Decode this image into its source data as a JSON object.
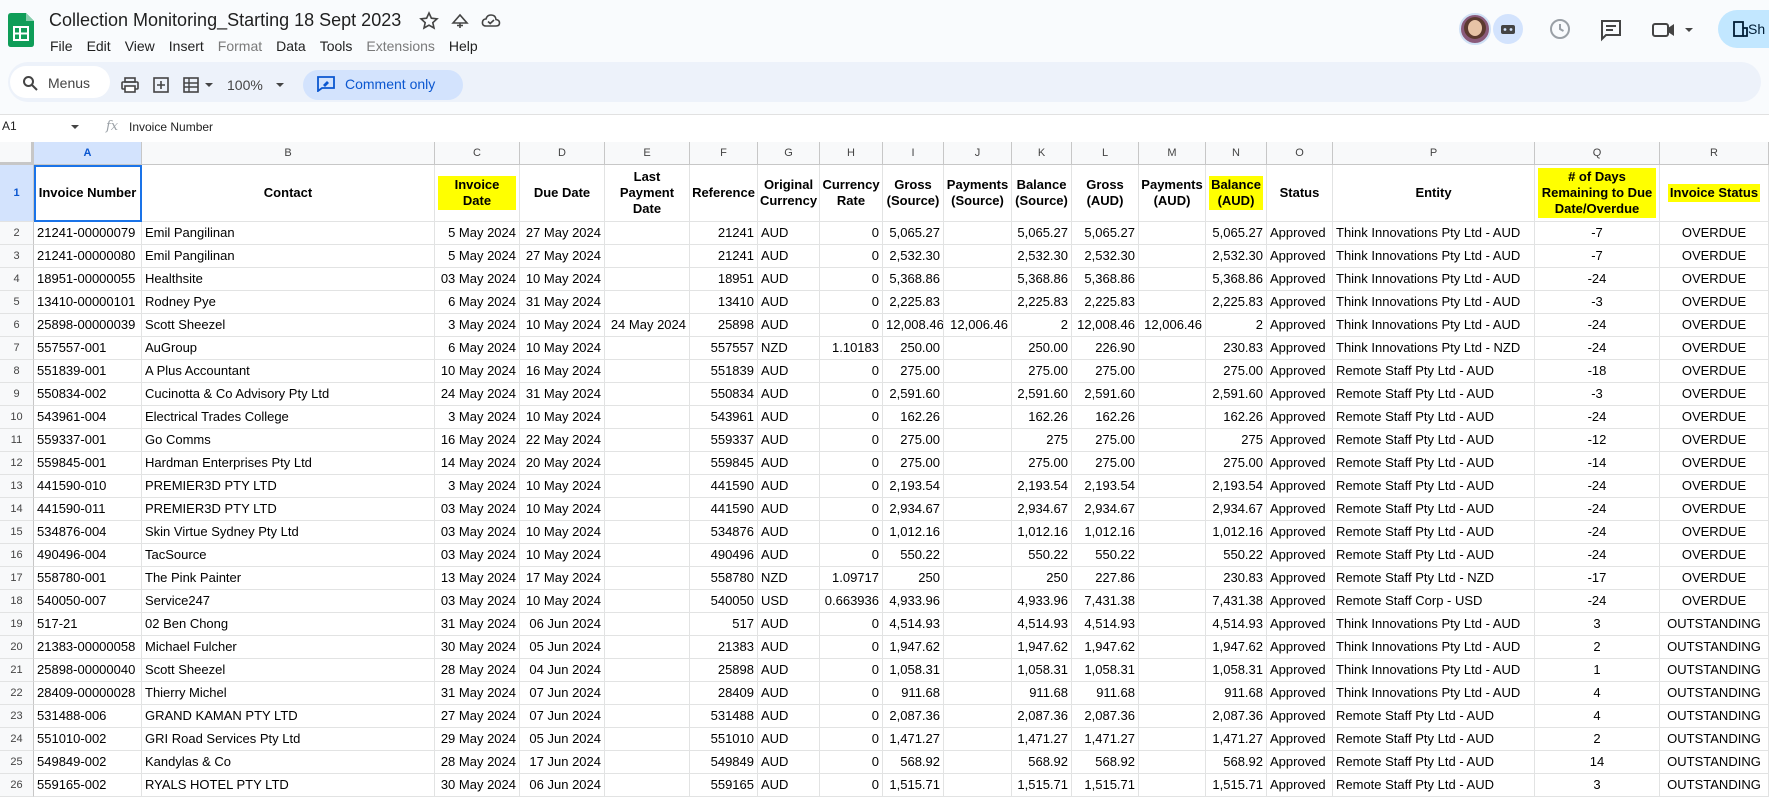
{
  "app": {
    "title": "Collection Monitoring_Starting 18 Sept 2023",
    "menu": [
      "File",
      "Edit",
      "View",
      "Insert",
      "Format",
      "Data",
      "Tools",
      "Extensions",
      "Help"
    ],
    "menu_disabled": [
      "Format",
      "Extensions"
    ],
    "share_label": "Sh"
  },
  "toolbar": {
    "menus_label": "Menus",
    "zoom": "100%",
    "comment_label": "Comment only"
  },
  "formula": {
    "name_box": "A1",
    "fx": "fx",
    "content": "Invoice Number"
  },
  "columns": [
    "A",
    "B",
    "C",
    "D",
    "E",
    "F",
    "G",
    "H",
    "I",
    "J",
    "K",
    "L",
    "M",
    "N",
    "O",
    "P",
    "Q",
    "R"
  ],
  "headers": [
    "Invoice Number",
    "Contact",
    "Invoice Date",
    "Due Date",
    "Last Payment Date",
    "Reference",
    "Original Currency",
    "Currency Rate",
    "Gross (Source)",
    "Payments (Source)",
    "Balance (Source)",
    "Gross (AUD)",
    "Payments (AUD)",
    "Balance (AUD)",
    "Status",
    "Entity",
    "# of Days Remaining to Due Date/Overdue",
    "Invoice Status"
  ],
  "highlighted_headers": [
    "C",
    "N",
    "Q",
    "R"
  ],
  "rows": [
    [
      "21241-00000079",
      "Emil Pangilinan",
      "5 May 2024",
      "27 May 2024",
      "",
      "21241",
      "AUD",
      "0",
      "5,065.27",
      "",
      "5,065.27",
      "5,065.27",
      "",
      "5,065.27",
      "Approved",
      "Think Innovations Pty Ltd - AUD",
      "-7",
      "OVERDUE"
    ],
    [
      "21241-00000080",
      "Emil Pangilinan",
      "5 May 2024",
      "27 May 2024",
      "",
      "21241",
      "AUD",
      "0",
      "2,532.30",
      "",
      "2,532.30",
      "2,532.30",
      "",
      "2,532.30",
      "Approved",
      "Think Innovations Pty Ltd - AUD",
      "-7",
      "OVERDUE"
    ],
    [
      "18951-00000055",
      "Healthsite",
      "03 May 2024",
      "10 May 2024",
      "",
      "18951",
      "AUD",
      "0",
      "5,368.86",
      "",
      "5,368.86",
      "5,368.86",
      "",
      "5,368.86",
      "Approved",
      "Think Innovations Pty Ltd - AUD",
      "-24",
      "OVERDUE"
    ],
    [
      "13410-00000101",
      "Rodney Pye",
      "6 May 2024",
      "31 May 2024",
      "",
      "13410",
      "AUD",
      "0",
      "2,225.83",
      "",
      "2,225.83",
      "2,225.83",
      "",
      "2,225.83",
      "Approved",
      "Think Innovations Pty Ltd - AUD",
      "-3",
      "OVERDUE"
    ],
    [
      "25898-00000039",
      "Scott Sheezel",
      "3 May 2024",
      "10 May 2024",
      "24 May 2024",
      "25898",
      "AUD",
      "0",
      "12,008.46",
      "12,006.46",
      "2",
      "12,008.46",
      "12,006.46",
      "2",
      "Approved",
      "Think Innovations Pty Ltd - AUD",
      "-24",
      "OVERDUE"
    ],
    [
      "557557-001",
      "AuGroup",
      "6 May 2024",
      "10 May 2024",
      "",
      "557557",
      "NZD",
      "1.10183",
      "250.00",
      "",
      "250.00",
      "226.90",
      "",
      "230.83",
      "Approved",
      "Think Innovations Pty Ltd - NZD",
      "-24",
      "OVERDUE"
    ],
    [
      "551839-001",
      "A Plus Accountant",
      "10 May 2024",
      "16 May 2024",
      "",
      "551839",
      "AUD",
      "0",
      "275.00",
      "",
      "275.00",
      "275.00",
      "",
      "275.00",
      "Approved",
      "Remote Staff Pty Ltd - AUD",
      "-18",
      "OVERDUE"
    ],
    [
      "550834-002",
      "Cucinotta & Co Advisory Pty Ltd",
      "24 May 2024",
      "31 May 2024",
      "",
      "550834",
      "AUD",
      "0",
      "2,591.60",
      "",
      "2,591.60",
      "2,591.60",
      "",
      "2,591.60",
      "Approved",
      "Remote Staff Pty Ltd - AUD",
      "-3",
      "OVERDUE"
    ],
    [
      "543961-004",
      "Electrical Trades College",
      "3 May 2024",
      "10 May 2024",
      "",
      "543961",
      "AUD",
      "0",
      "162.26",
      "",
      "162.26",
      "162.26",
      "",
      "162.26",
      "Approved",
      "Remote Staff Pty Ltd - AUD",
      "-24",
      "OVERDUE"
    ],
    [
      "559337-001",
      "Go Comms",
      "16 May 2024",
      "22 May 2024",
      "",
      "559337",
      "AUD",
      "0",
      "275.00",
      "",
      "275",
      "275.00",
      "",
      "275",
      "Approved",
      "Remote Staff Pty Ltd - AUD",
      "-12",
      "OVERDUE"
    ],
    [
      "559845-001",
      "Hardman Enterprises Pty Ltd",
      "14 May 2024",
      "20 May 2024",
      "",
      "559845",
      "AUD",
      "0",
      "275.00",
      "",
      "275.00",
      "275.00",
      "",
      "275.00",
      "Approved",
      "Remote Staff Pty Ltd - AUD",
      "-14",
      "OVERDUE"
    ],
    [
      "441590-010",
      "PREMIER3D PTY LTD",
      "3 May 2024",
      "10 May 2024",
      "",
      "441590",
      "AUD",
      "0",
      "2,193.54",
      "",
      "2,193.54",
      "2,193.54",
      "",
      "2,193.54",
      "Approved",
      "Remote Staff Pty Ltd - AUD",
      "-24",
      "OVERDUE"
    ],
    [
      "441590-011",
      "PREMIER3D PTY LTD",
      "03 May 2024",
      "10 May 2024",
      "",
      "441590",
      "AUD",
      "0",
      "2,934.67",
      "",
      "2,934.67",
      "2,934.67",
      "",
      "2,934.67",
      "Approved",
      "Remote Staff Pty Ltd - AUD",
      "-24",
      "OVERDUE"
    ],
    [
      "534876-004",
      "Skin Virtue Sydney Pty Ltd",
      "03 May 2024",
      "10 May 2024",
      "",
      "534876",
      "AUD",
      "0",
      "1,012.16",
      "",
      "1,012.16",
      "1,012.16",
      "",
      "1,012.16",
      "Approved",
      "Remote Staff Pty Ltd - AUD",
      "-24",
      "OVERDUE"
    ],
    [
      "490496-004",
      "TacSource",
      "03 May 2024",
      "10 May 2024",
      "",
      "490496",
      "AUD",
      "0",
      "550.22",
      "",
      "550.22",
      "550.22",
      "",
      "550.22",
      "Approved",
      "Remote Staff Pty Ltd - AUD",
      "-24",
      "OVERDUE"
    ],
    [
      "558780-001",
      "The Pink Painter",
      "13 May 2024",
      "17 May 2024",
      "",
      "558780",
      "NZD",
      "1.09717",
      "250",
      "",
      "250",
      "227.86",
      "",
      "230.83",
      "Approved",
      "Remote Staff Pty Ltd - NZD",
      "-17",
      "OVERDUE"
    ],
    [
      "540050-007",
      "Service247",
      "03 May 2024",
      "10 May 2024",
      "",
      "540050",
      "USD",
      "0.663936",
      "4,933.96",
      "",
      "4,933.96",
      "7,431.38",
      "",
      "7,431.38",
      "Approved",
      "Remote Staff Corp - USD",
      "-24",
      "OVERDUE"
    ],
    [
      "517-21",
      "02 Ben Chong",
      "31 May 2024",
      "06 Jun 2024",
      "",
      "517",
      "AUD",
      "0",
      "4,514.93",
      "",
      "4,514.93",
      "4,514.93",
      "",
      "4,514.93",
      "Approved",
      "Think Innovations Pty Ltd - AUD",
      "3",
      "OUTSTANDING"
    ],
    [
      "21383-00000058",
      "Michael Fulcher",
      "30 May 2024",
      "05 Jun 2024",
      "",
      "21383",
      "AUD",
      "0",
      "1,947.62",
      "",
      "1,947.62",
      "1,947.62",
      "",
      "1,947.62",
      "Approved",
      "Think Innovations Pty Ltd - AUD",
      "2",
      "OUTSTANDING"
    ],
    [
      "25898-00000040",
      "Scott Sheezel",
      "28 May 2024",
      "04 Jun 2024",
      "",
      "25898",
      "AUD",
      "0",
      "1,058.31",
      "",
      "1,058.31",
      "1,058.31",
      "",
      "1,058.31",
      "Approved",
      "Think Innovations Pty Ltd - AUD",
      "1",
      "OUTSTANDING"
    ],
    [
      "28409-00000028",
      "Thierry Michel",
      "31 May 2024",
      "07 Jun 2024",
      "",
      "28409",
      "AUD",
      "0",
      "911.68",
      "",
      "911.68",
      "911.68",
      "",
      "911.68",
      "Approved",
      "Think Innovations Pty Ltd - AUD",
      "4",
      "OUTSTANDING"
    ],
    [
      "531488-006",
      "GRAND KAMAN PTY LTD",
      "27 May 2024",
      "07 Jun 2024",
      "",
      "531488",
      "AUD",
      "0",
      "2,087.36",
      "",
      "2,087.36",
      "2,087.36",
      "",
      "2,087.36",
      "Approved",
      "Remote Staff Pty Ltd - AUD",
      "4",
      "OUTSTANDING"
    ],
    [
      "551010-002",
      "GRI Road Services Pty Ltd",
      "29 May 2024",
      "05 Jun 2024",
      "",
      "551010",
      "AUD",
      "0",
      "1,471.27",
      "",
      "1,471.27",
      "1,471.27",
      "",
      "1,471.27",
      "Approved",
      "Remote Staff Pty Ltd - AUD",
      "2",
      "OUTSTANDING"
    ],
    [
      "549849-002",
      "Kandylas & Co",
      "28 May 2024",
      "17 Jun 2024",
      "",
      "549849",
      "AUD",
      "0",
      "568.92",
      "",
      "568.92",
      "568.92",
      "",
      "568.92",
      "Approved",
      "Remote Staff Pty Ltd - AUD",
      "14",
      "OUTSTANDING"
    ],
    [
      "559165-002",
      "RYALS HOTEL PTY LTD",
      "30 May 2024",
      "06 Jun 2024",
      "",
      "559165",
      "AUD",
      "0",
      "1,515.71",
      "",
      "1,515.71",
      "1,515.71",
      "",
      "1,515.71",
      "Approved",
      "Remote Staff Pty Ltd - AUD",
      "3",
      "OUTSTANDING"
    ]
  ],
  "icons": [
    "sheets-logo-icon",
    "star-icon",
    "move-icon",
    "cloud-status-icon",
    "avatar",
    "bot-icon",
    "history-icon",
    "comment-icon",
    "video-icon",
    "share-icon",
    "search-icon",
    "print-icon",
    "add-icon",
    "format-icon",
    "comment-only-icon",
    "fx-icon"
  ],
  "colors": {
    "highlight": "#ffff00",
    "selection": "#1a73e8",
    "accent": "#0b57d0"
  }
}
